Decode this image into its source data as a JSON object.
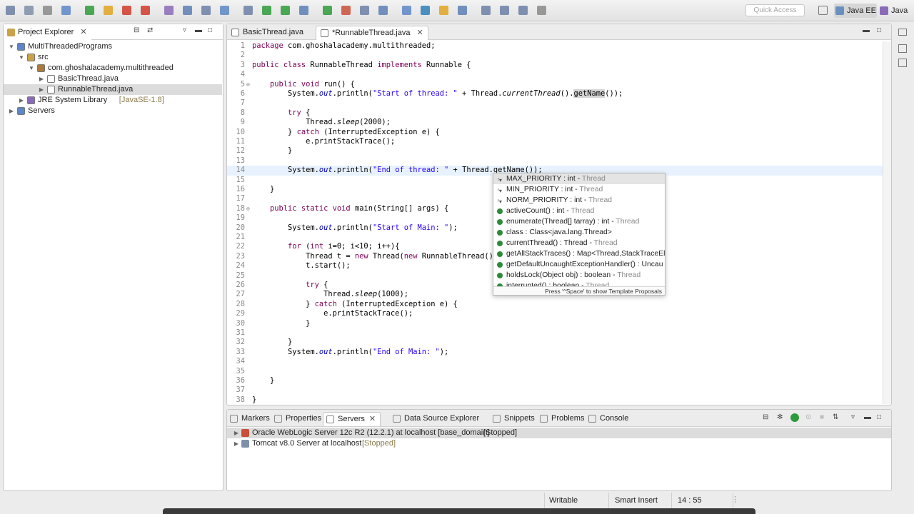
{
  "toolbar": {
    "quick_access_placeholder": "Quick Access",
    "perspectives": [
      "Java EE",
      "Java"
    ]
  },
  "project_explorer": {
    "title": "Project Explorer",
    "tree": [
      {
        "label": "MultiThreadedPrograms",
        "depth": 0,
        "expanded": true,
        "icon": "project-icon"
      },
      {
        "label": "src",
        "depth": 1,
        "expanded": true,
        "icon": "source-folder-icon"
      },
      {
        "label": "com.ghoshalacademy.multithreaded",
        "depth": 2,
        "expanded": true,
        "icon": "package-icon"
      },
      {
        "label": "BasicThread.java",
        "depth": 3,
        "expanded": false,
        "icon": "java-file-icon"
      },
      {
        "label": "RunnableThread.java",
        "depth": 3,
        "expanded": false,
        "icon": "java-file-icon",
        "selected": true
      },
      {
        "label": "JRE System Library",
        "suffix": "[JavaSE-1.8]",
        "depth": 1,
        "expanded": false,
        "icon": "library-icon"
      },
      {
        "label": "Servers",
        "depth": 0,
        "expanded": false,
        "icon": "folder-icon"
      }
    ]
  },
  "editor": {
    "tabs": [
      {
        "label": "BasicThread.java",
        "active": false
      },
      {
        "label": "*RunnableThread.java",
        "active": true
      }
    ],
    "lines": [
      {
        "n": "1",
        "text": "package com.ghoshalacademy.multithreaded;"
      },
      {
        "n": "2",
        "text": ""
      },
      {
        "n": "3",
        "text": "public class RunnableThread implements Runnable {"
      },
      {
        "n": "4",
        "text": ""
      },
      {
        "n": "5",
        "text": "    public void run() {"
      },
      {
        "n": "6",
        "text": "        System.out.println(\"Start of thread: \" + Thread.currentThread().getName());"
      },
      {
        "n": "7",
        "text": ""
      },
      {
        "n": "8",
        "text": "        try {"
      },
      {
        "n": "9",
        "text": "            Thread.sleep(2000);"
      },
      {
        "n": "10",
        "text": "        } catch (InterruptedException e) {"
      },
      {
        "n": "11",
        "text": "            e.printStackTrace();"
      },
      {
        "n": "12",
        "text": "        }"
      },
      {
        "n": "13",
        "text": ""
      },
      {
        "n": "14",
        "text": "        System.out.println(\"End of thread: \" + Thread.getName());"
      },
      {
        "n": "15",
        "text": ""
      },
      {
        "n": "16",
        "text": "    }"
      },
      {
        "n": "17",
        "text": ""
      },
      {
        "n": "18",
        "text": "    public static void main(String[] args) {"
      },
      {
        "n": "19",
        "text": ""
      },
      {
        "n": "20",
        "text": "        System.out.println(\"Start of Main: \");"
      },
      {
        "n": "21",
        "text": ""
      },
      {
        "n": "22",
        "text": "        for (int i=0; i<10; i++){"
      },
      {
        "n": "23",
        "text": "            Thread t = new Thread(new RunnableThread()"
      },
      {
        "n": "24",
        "text": "            t.start();"
      },
      {
        "n": "25",
        "text": ""
      },
      {
        "n": "26",
        "text": "            try {"
      },
      {
        "n": "27",
        "text": "                Thread.sleep(1000);"
      },
      {
        "n": "28",
        "text": "            } catch (InterruptedException e) {"
      },
      {
        "n": "29",
        "text": "                e.printStackTrace();"
      },
      {
        "n": "30",
        "text": "            }"
      },
      {
        "n": "31",
        "text": ""
      },
      {
        "n": "32",
        "text": "        }"
      },
      {
        "n": "33",
        "text": "        System.out.println(\"End of Main: \");"
      },
      {
        "n": "34",
        "text": ""
      },
      {
        "n": "35",
        "text": ""
      },
      {
        "n": "36",
        "text": "    }"
      },
      {
        "n": "37",
        "text": ""
      },
      {
        "n": "38",
        "text": "}"
      }
    ]
  },
  "completion": {
    "items": [
      {
        "main": "MAX_PRIORITY : int - ",
        "owner": "Thread",
        "kind": "field",
        "selected": true
      },
      {
        "main": "MIN_PRIORITY : int - ",
        "owner": "Thread",
        "kind": "field"
      },
      {
        "main": "NORM_PRIORITY : int - ",
        "owner": "Thread",
        "kind": "field"
      },
      {
        "main": "activeCount() : int - ",
        "owner": "Thread",
        "kind": "method"
      },
      {
        "main": "enumerate(Thread[] tarray) : int - ",
        "owner": "Thread",
        "kind": "method"
      },
      {
        "main": "class : Class<java.lang.Thread>",
        "owner": "",
        "kind": "method"
      },
      {
        "main": "currentThread() : Thread - ",
        "owner": "Thread",
        "kind": "method"
      },
      {
        "main": "getAllStackTraces() : Map<Thread,StackTraceEl",
        "owner": "",
        "kind": "method"
      },
      {
        "main": "getDefaultUncaughtExceptionHandler() : Uncau",
        "owner": "",
        "kind": "method"
      },
      {
        "main": "holdsLock(Object obj) : boolean - ",
        "owner": "Thread",
        "kind": "method"
      },
      {
        "main": "interrupted() : boolean - ",
        "owner": "Thread",
        "kind": "method"
      }
    ],
    "hint": "Press '^Space' to show Template Proposals"
  },
  "bottom_panel": {
    "tabs": [
      {
        "label": "Markers",
        "active": false
      },
      {
        "label": "Properties",
        "active": false
      },
      {
        "label": "Servers",
        "active": true
      },
      {
        "label": "Data Source Explorer",
        "active": false
      },
      {
        "label": "Snippets",
        "active": false
      },
      {
        "label": "Problems",
        "active": false
      },
      {
        "label": "Console",
        "active": false
      }
    ],
    "servers": [
      {
        "name": "Oracle WebLogic Server 12c R2 (12.2.1) at localhost [base_domain]",
        "state": "[Stopped]"
      },
      {
        "name": "Tomcat v8.0 Server at localhost",
        "state": "[Stopped]"
      }
    ]
  },
  "status": {
    "writable": "Writable",
    "insert_mode": "Smart Insert",
    "position": "14 : 55"
  }
}
